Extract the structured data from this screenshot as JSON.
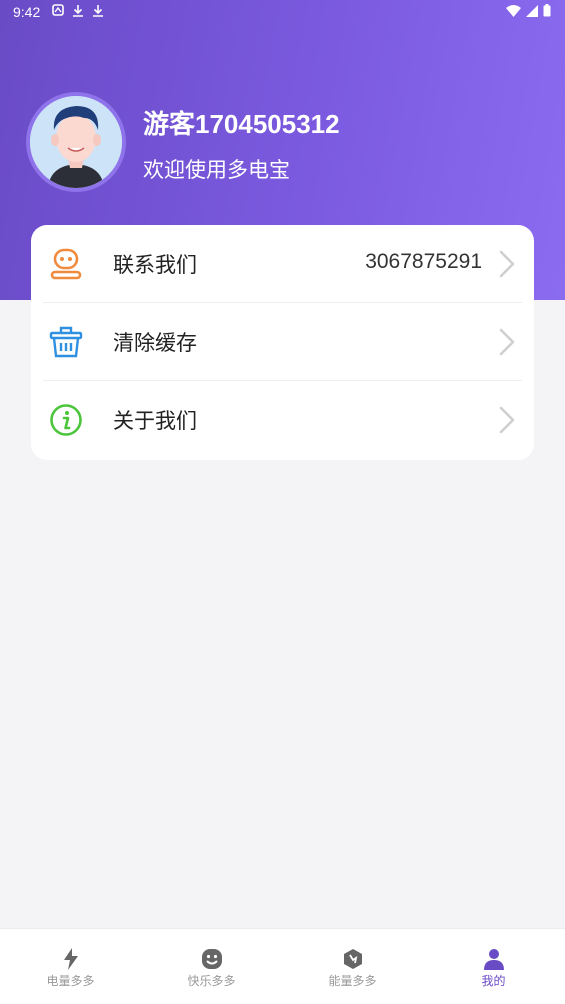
{
  "status_bar": {
    "time": "9:42"
  },
  "profile": {
    "name": "游客1704505312",
    "subtitle": "欢迎使用多电宝"
  },
  "menu": {
    "items": [
      {
        "label": "联系我们",
        "value": "3067875291",
        "icon": "contact-icon"
      },
      {
        "label": "清除缓存",
        "value": "",
        "icon": "trash-basket-icon"
      },
      {
        "label": "关于我们",
        "value": "",
        "icon": "info-icon"
      }
    ]
  },
  "tabbar": {
    "tabs": [
      {
        "label": "电量多多",
        "icon": "lightning-icon",
        "active": false
      },
      {
        "label": "快乐多多",
        "icon": "smile-icon",
        "active": false
      },
      {
        "label": "能量多多",
        "icon": "energy-icon",
        "active": false
      },
      {
        "label": "我的",
        "icon": "person-icon",
        "active": true
      }
    ]
  },
  "colors": {
    "header_start": "#6a4bc6",
    "header_end": "#8b6cf0",
    "accent": "#6a4bc6",
    "contact_icon": "#f08a3c",
    "trash_icon": "#2f8fe0",
    "info_icon": "#4cc43c"
  }
}
